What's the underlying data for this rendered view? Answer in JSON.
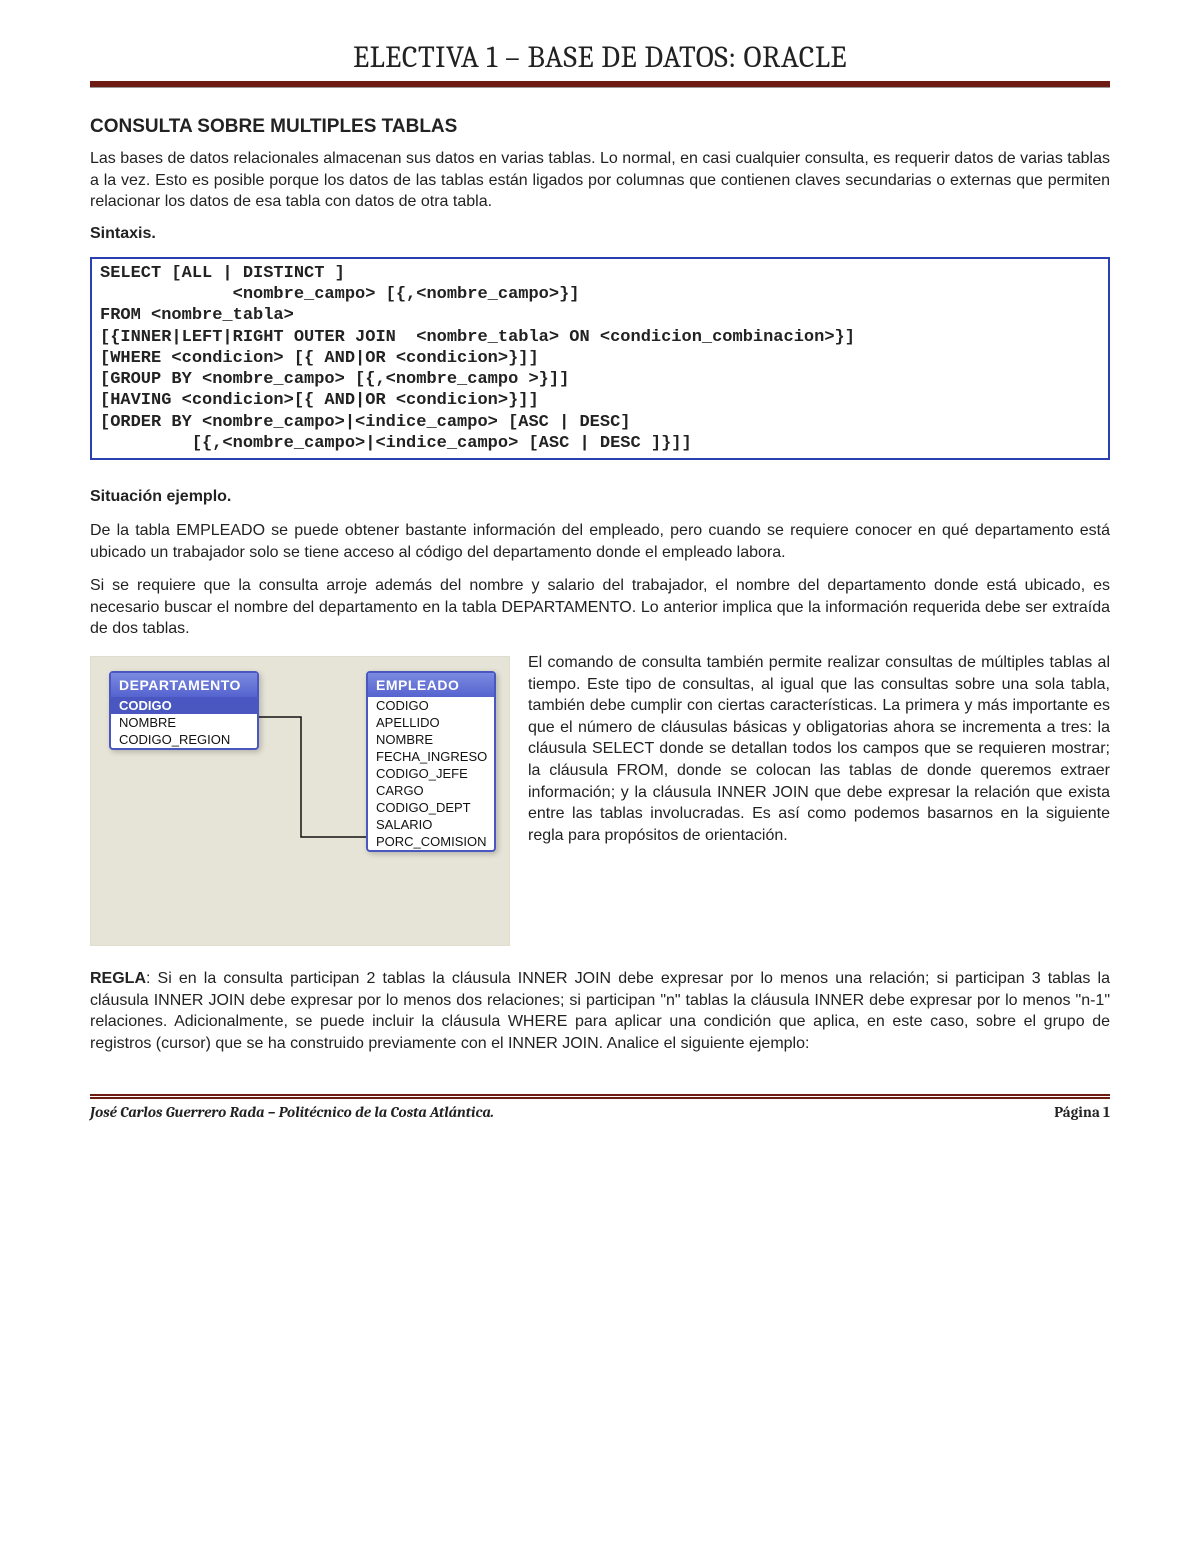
{
  "header": {
    "title": "ELECTIVA 1 – BASE DE DATOS: ORACLE"
  },
  "section1": {
    "heading": "CONSULTA SOBRE MULTIPLES TABLAS",
    "para1": "Las bases de datos relacionales almacenan sus datos en varias tablas. Lo normal, en casi cualquier consulta, es requerir datos de varias tablas a la vez. Esto es posible porque los datos de las tablas están ligados por columnas que contienen claves secundarias o externas que permiten relacionar los datos de esa tabla con datos de otra tabla.",
    "sintaxis_label": "Sintaxis."
  },
  "syntax_block": "SELECT [ALL | DISTINCT ]\n             <nombre_campo> [{,<nombre_campo>}]\nFROM <nombre_tabla>\n[{INNER|LEFT|RIGHT OUTER JOIN  <nombre_tabla> ON <condicion_combinacion>}]\n[WHERE <condicion> [{ AND|OR <condicion>}]]\n[GROUP BY <nombre_campo> [{,<nombre_campo >}]]\n[HAVING <condicion>[{ AND|OR <condicion>}]]\n[ORDER BY <nombre_campo>|<indice_campo> [ASC | DESC]\n         [{,<nombre_campo>|<indice_campo> [ASC | DESC ]}]]",
  "section2": {
    "heading": "Situación ejemplo.",
    "para1": "De la tabla EMPLEADO se puede obtener bastante información del empleado, pero cuando se requiere conocer en qué departamento está ubicado un trabajador solo se tiene acceso al código del departamento donde el empleado labora.",
    "para2": "Si se requiere que la consulta arroje además del nombre y salario del trabajador, el nombre del departamento donde está ubicado, es necesario buscar el nombre del departamento en la tabla DEPARTAMENTO. Lo anterior implica que la información requerida debe ser extraída de dos tablas."
  },
  "diagram": {
    "table1": {
      "name": "DEPARTAMENTO",
      "fields": [
        "CODIGO",
        "NOMBRE",
        "CODIGO_REGION"
      ],
      "pk_index": 0
    },
    "table2": {
      "name": "EMPLEADO",
      "fields": [
        "CODIGO",
        "APELLIDO",
        "NOMBRE",
        "FECHA_INGRESO",
        "CODIGO_JEFE",
        "CARGO",
        "CODIGO_DEPT",
        "SALARIO",
        "PORC_COMISION"
      ]
    }
  },
  "wrap_para": "El comando de consulta también permite realizar consultas de múltiples tablas al tiempo. Este tipo de consultas, al igual que las consultas sobre una sola tabla, también debe cumplir con ciertas características. La primera y más importante es que el número de cláusulas básicas y obligatorias ahora se incrementa a tres: la cláusula SELECT donde se detallan todos los campos que se requieren mostrar; la cláusula FROM, donde se colocan las tablas de donde queremos extraer información; y la cláusula INNER JOIN que debe expresar la relación que exista entre las tablas involucradas. Es así como podemos basarnos en la siguiente regla para propósitos de orientación.",
  "regla": {
    "label": "REGLA",
    "text": ": Si en la consulta participan 2 tablas la cláusula INNER JOIN debe expresar por lo menos una relación; si participan 3 tablas la cláusula INNER JOIN debe expresar por lo menos dos relaciones; si participan \"n\" tablas la cláusula INNER debe expresar por lo menos \"n-1\" relaciones. Adicionalmente, se puede incluir la cláusula WHERE para aplicar una condición que aplica, en este caso, sobre el grupo de registros (cursor) que se ha construido previamente con el INNER JOIN. Analice el siguiente ejemplo:"
  },
  "footer": {
    "left": "José Carlos Guerrero Rada – Politécnico de la Costa Atlántica.",
    "right": "Página 1"
  }
}
